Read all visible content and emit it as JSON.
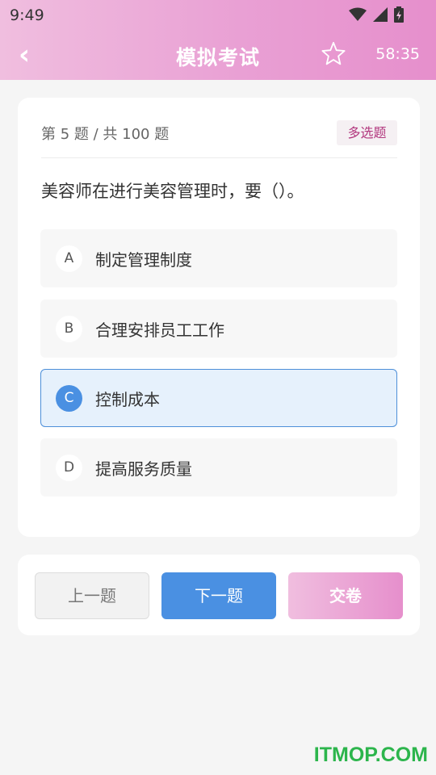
{
  "status_bar": {
    "time": "9:49"
  },
  "header": {
    "title": "模拟考试",
    "timer": "58:35",
    "back_icon": "back-arrow-icon",
    "favorite_icon": "star-outline-icon"
  },
  "question": {
    "meta": "第 5 题 / 共 100 题",
    "type_badge": "多选题",
    "text": "美容师在进行美容管理时，要（）。",
    "options": [
      {
        "letter": "A",
        "text": "制定管理制度",
        "selected": false
      },
      {
        "letter": "B",
        "text": "合理安排员工工作",
        "selected": false
      },
      {
        "letter": "C",
        "text": "控制成本",
        "selected": true
      },
      {
        "letter": "D",
        "text": "提高服务质量",
        "selected": false
      }
    ]
  },
  "nav": {
    "prev_label": "上一题",
    "next_label": "下一题",
    "submit_label": "交卷"
  },
  "watermark": "ITMOP.COM",
  "colors": {
    "accent_pink": "#e68fcc",
    "accent_blue": "#4a90e2",
    "badge_text": "#b2377e"
  }
}
